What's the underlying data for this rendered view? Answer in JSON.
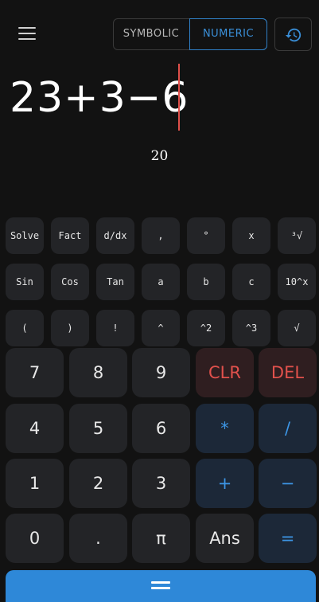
{
  "header": {
    "menu_icon": "hamburger-menu-icon",
    "mode_symbolic": "SYMBOLIC",
    "mode_numeric": "NUMERIC",
    "history_icon": "history-icon",
    "accent_color": "#2f7fc6"
  },
  "display": {
    "expression": "23+3−6",
    "result": "20",
    "cursor_color": "#e0504a"
  },
  "sci_keys": [
    [
      "Solve",
      "Fact",
      "d/dx",
      ",",
      "°",
      "x",
      "³√"
    ],
    [
      "Sin",
      "Cos",
      "Tan",
      "a",
      "b",
      "c",
      "10^x"
    ],
    [
      "(",
      ")",
      "!",
      "^",
      "^2",
      "^3",
      "√"
    ]
  ],
  "main_keys": [
    [
      "7",
      "8",
      "9",
      "CLR",
      "DEL"
    ],
    [
      "4",
      "5",
      "6",
      "*",
      "/"
    ],
    [
      "1",
      "2",
      "3",
      "+",
      "−"
    ],
    [
      "0",
      ".",
      "π",
      "Ans",
      "="
    ]
  ],
  "equals_bar_icon": "equals-icon"
}
